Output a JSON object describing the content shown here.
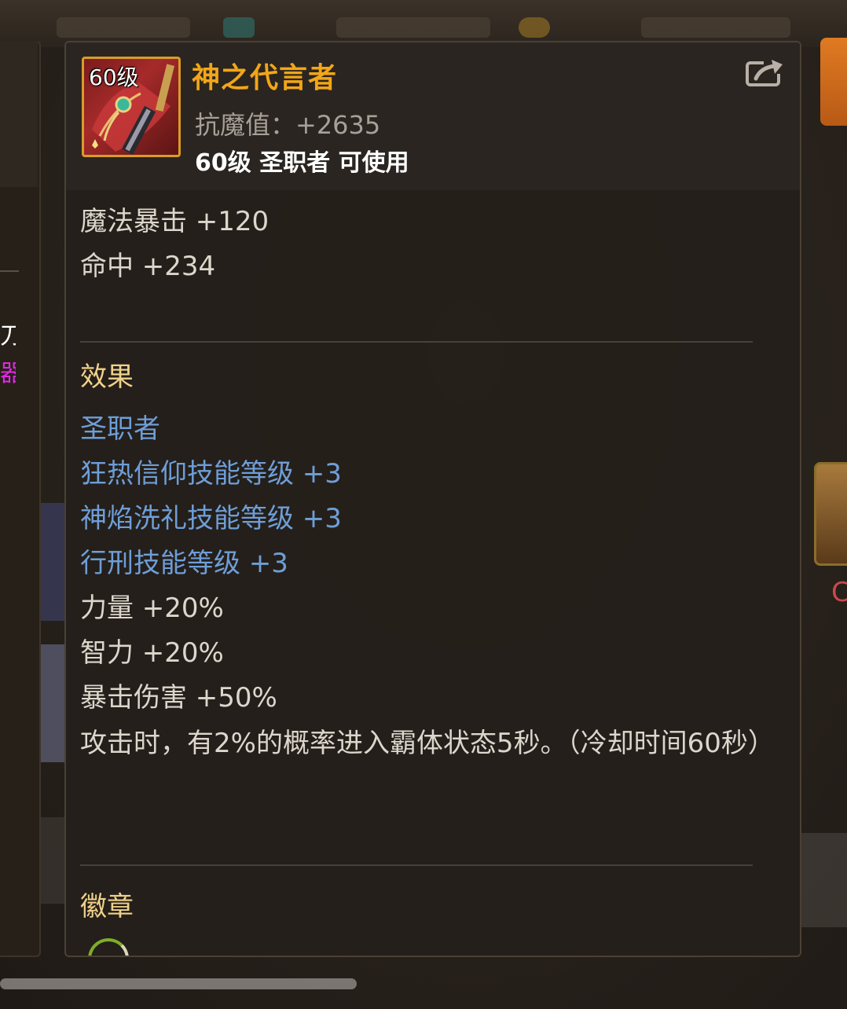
{
  "background": {
    "left_text_white": "刀",
    "left_text_magenta": "器",
    "right_text_red": "C"
  },
  "item": {
    "icon_level": "60级",
    "icon_name": "cross-staff-icon",
    "name": "神之代言者",
    "stat_line": "抗魔值：+2635",
    "requirement": "60级 圣职者 可使用",
    "share_icon": "share-icon"
  },
  "base_stats": [
    "魔法暴击 +120",
    "命中 +234"
  ],
  "effects": {
    "heading": "效果",
    "class_heading": "圣职者",
    "skill_lines": [
      "狂热信仰技能等级 +3",
      "神焰洗礼技能等级 +3",
      "行刑技能等级 +3"
    ],
    "stat_lines": [
      "力量 +20%",
      "智力 +20%",
      "暴击伤害 +50%"
    ],
    "proc_text": "攻击时，有2%的概率进入霸体状态5秒。（冷却时间60秒）"
  },
  "badge": {
    "heading": "徽章"
  },
  "colors": {
    "item_name": "#f2a618",
    "skill_blue": "#6e9ed8",
    "heading_gold": "#f0d28a",
    "icon_border": "#d99b2a"
  }
}
